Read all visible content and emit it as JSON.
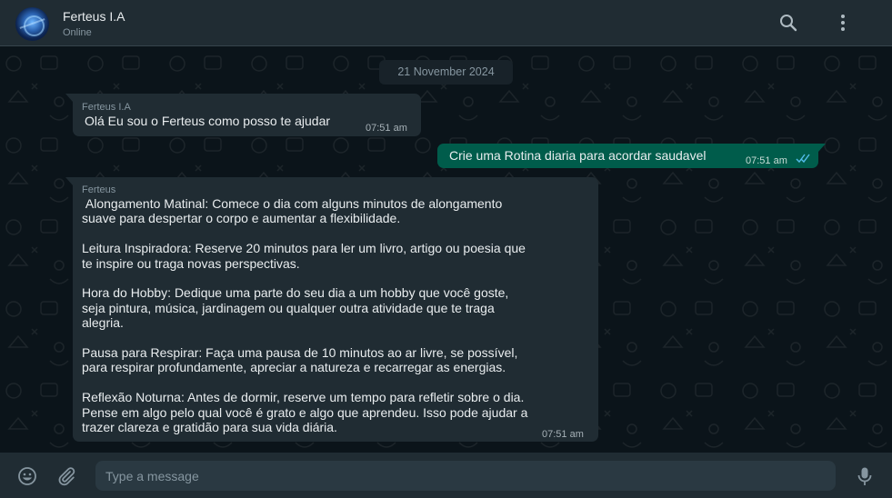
{
  "header": {
    "contact_name": "Ferteus I.A",
    "status": "Online",
    "icons": [
      "avatar",
      "search-icon",
      "more-vert-icon"
    ]
  },
  "chat": {
    "date_separator": "21 November 2024",
    "messages": [
      {
        "direction": "incoming",
        "sender": "Ferteus I.A",
        "text": "Olá Eu sou o Ferteus como posso te ajudar",
        "time": "07:51 am"
      },
      {
        "direction": "outgoing",
        "text": "Crie uma Rotina diaria para acordar saudavel",
        "time": "07:51 am",
        "status": "read"
      },
      {
        "direction": "incoming",
        "sender": "Ferteus",
        "text": " Alongamento Matinal: Comece o dia com alguns minutos de alongamento\nsuave para despertar o corpo e aumentar a flexibilidade.\n\nLeitura Inspiradora: Reserve 20 minutos para ler um livro, artigo ou poesia que\nte inspire ou traga novas perspectivas.\n\nHora do Hobby: Dedique uma parte do seu dia a um hobby que você goste,\nseja pintura, música, jardinagem ou qualquer outra atividade que te traga\nalegria.\n\nPausa para Respirar: Faça uma pausa de 10 minutos ao ar livre, se possível,\npara respirar profundamente, apreciar a natureza e recarregar as energias.\n\nReflexão Noturna: Antes de dormir, reserve um tempo para refletir sobre o dia.\nPense em algo pelo qual você é grato e algo que aprendeu. Isso pode ajudar a\ntrazer clareza e gratidão para sua vida diária.",
        "time": "07:51 am"
      }
    ]
  },
  "footer": {
    "input_placeholder": "Type a message",
    "icons": [
      "emoji-icon",
      "attach-icon",
      "mic-icon"
    ]
  },
  "colors": {
    "header_bg": "#202c33",
    "chat_bg": "#0b141a",
    "incoming_bubble": "#202c33",
    "outgoing_bubble": "#005c4b",
    "read_ticks": "#53bdeb"
  }
}
